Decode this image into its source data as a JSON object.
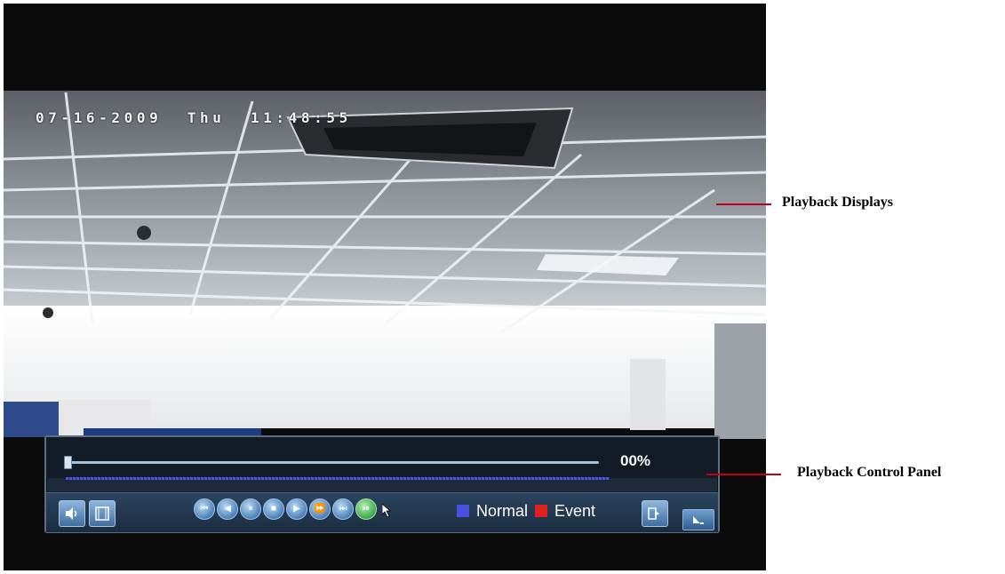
{
  "screen": {
    "osd_timestamp": "07-16-2009 Thu 11:48:55"
  },
  "control_panel": {
    "progress": {
      "percent_text": "00%",
      "fraction": 0.0
    },
    "buttons": {
      "audio": "audio-icon",
      "clip": "clip-icon",
      "playback": [
        {
          "name": "skip-back-icon",
          "glyph": "⏮"
        },
        {
          "name": "reverse-play-icon",
          "glyph": "◀"
        },
        {
          "name": "pause-icon",
          "glyph": "⏸"
        },
        {
          "name": "stop-icon",
          "glyph": "■"
        },
        {
          "name": "play-icon",
          "glyph": "▶"
        },
        {
          "name": "fast-forward-icon",
          "glyph": "⏩"
        },
        {
          "name": "slow-forward-icon",
          "glyph": "⏭"
        },
        {
          "name": "step-forward-icon",
          "glyph": "⏯"
        }
      ],
      "exit": "exit-icon",
      "hide": "hide-panel-icon"
    },
    "legend": {
      "normal": {
        "label": "Normal",
        "color": "#4750e0"
      },
      "event": {
        "label": "Event",
        "color": "#e02020"
      }
    }
  },
  "callouts": {
    "displays": "Playback Displays",
    "control_panel": "Playback Control Panel"
  },
  "colors": {
    "callout_line": "#c0001a",
    "panel": "#1c2a3a"
  }
}
